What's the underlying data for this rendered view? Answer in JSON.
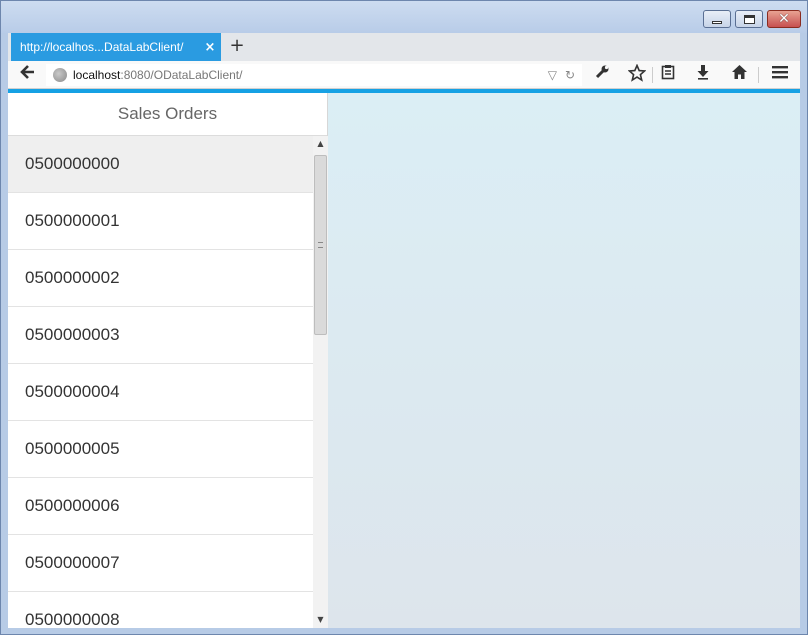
{
  "browser": {
    "tab_title": "http://localhos...DataLabClient/",
    "tab_close": "×",
    "new_tab": "+",
    "url_host": "localhost",
    "url_rest": ":8080/ODataLabClient/"
  },
  "master": {
    "title": "Sales Orders",
    "items": [
      "0500000000",
      "0500000001",
      "0500000002",
      "0500000003",
      "0500000004",
      "0500000005",
      "0500000006",
      "0500000007",
      "0500000008"
    ],
    "selected_index": 0
  },
  "colors": {
    "accent": "#16a1e4",
    "tab_active": "#2a9be1",
    "detail_bg": "#dbeef5"
  }
}
